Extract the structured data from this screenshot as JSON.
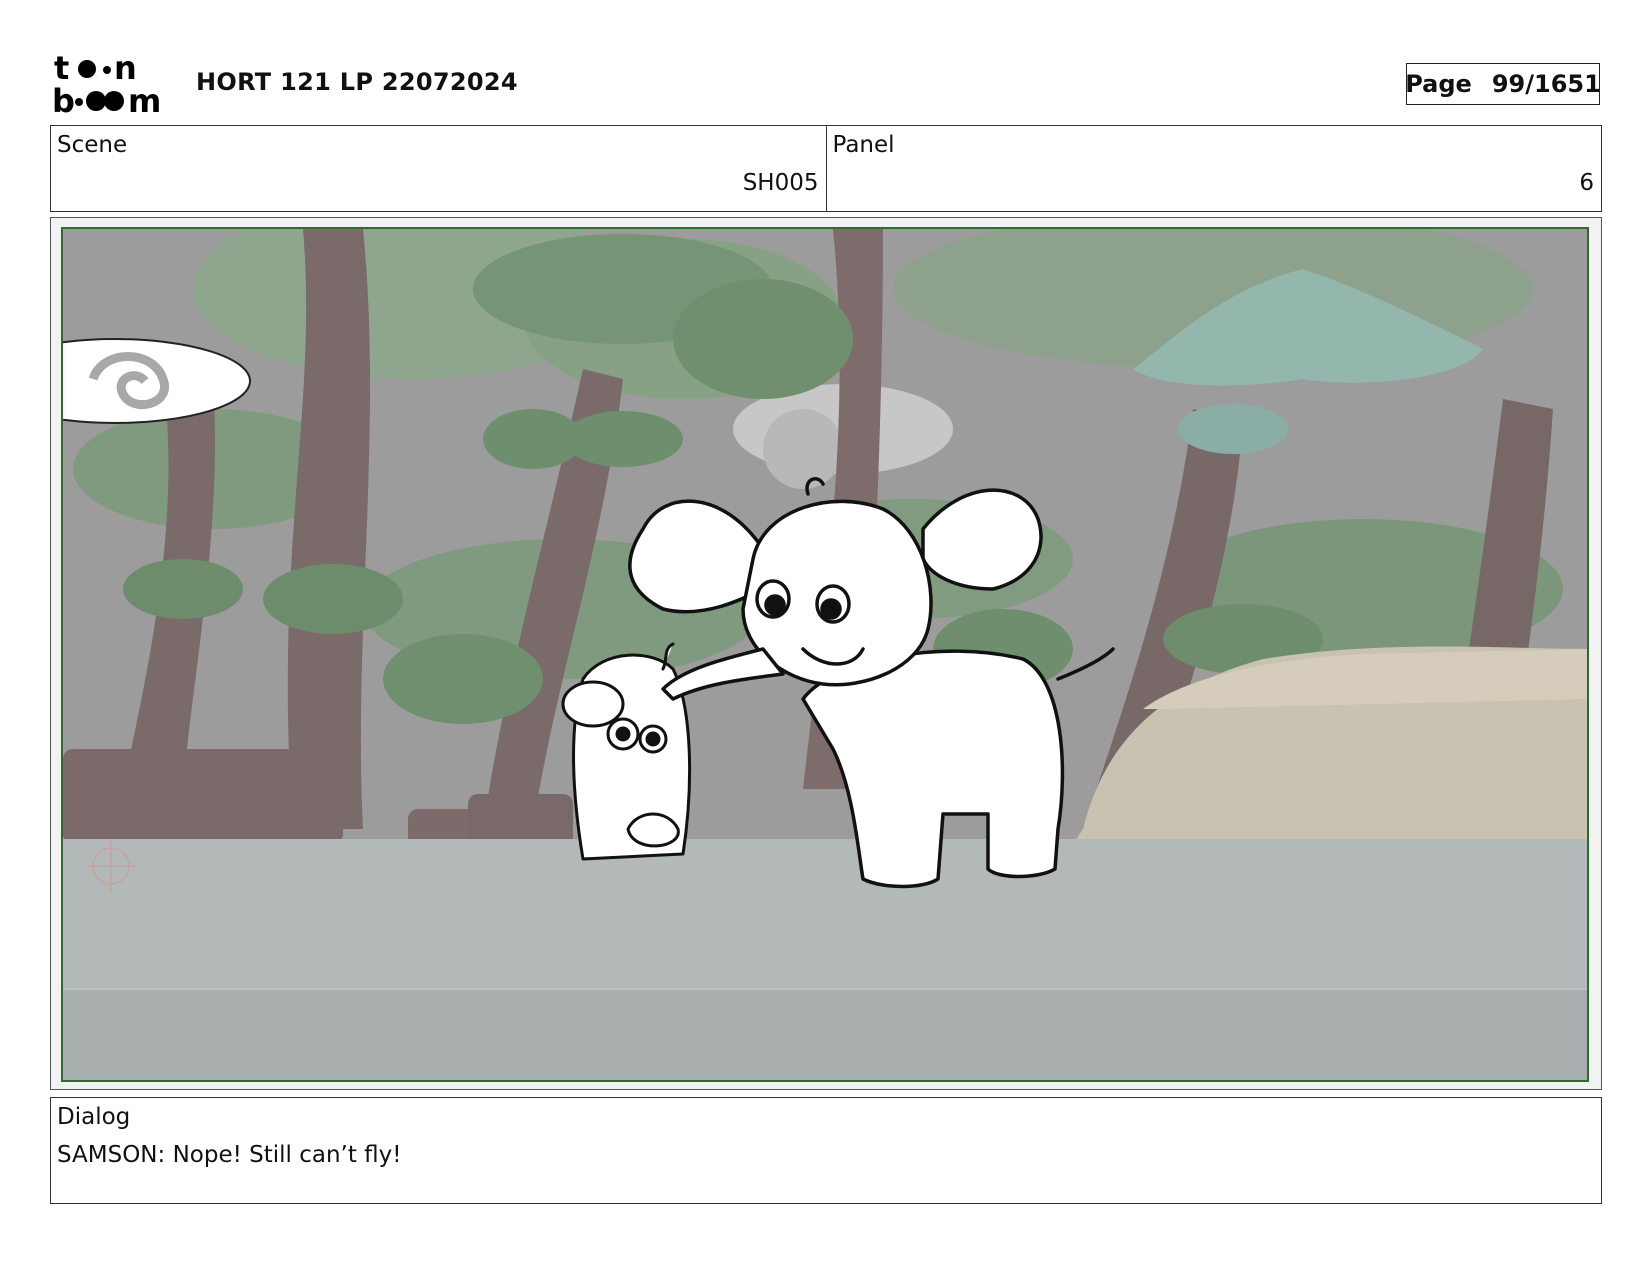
{
  "header": {
    "logo_text": "toon boom",
    "title": "HORT 121 LP 22072024",
    "page_label": "Page",
    "page_value": "99/1651"
  },
  "info": {
    "scene_label": "Scene",
    "scene_value": "SH005",
    "panel_label": "Panel",
    "panel_value": "6"
  },
  "dialog": {
    "label": "Dialog",
    "text": "SAMSON: Nope! Still can’t fly!"
  },
  "colors": {
    "frame_border": "#2e6b2e",
    "background": "#9d9d9d",
    "ground": "#b4b9ba"
  }
}
